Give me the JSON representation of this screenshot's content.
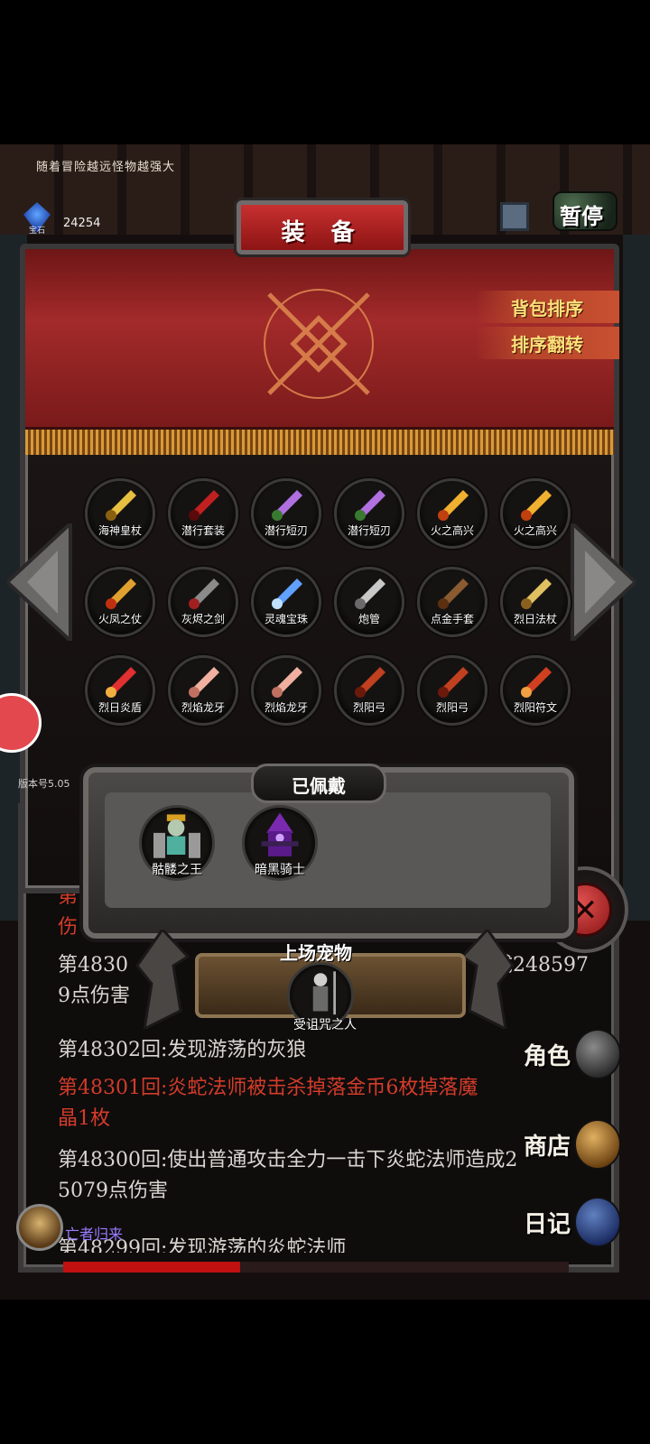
{
  "top_tip": "随着冒险越远怪物越强大",
  "gem": {
    "label": "宝石",
    "count": "24254",
    "icon": "blue-gem-icon"
  },
  "pause_label": "暂停",
  "panel": {
    "title": "装 备",
    "sort_bag": "背包排序",
    "sort_reverse": "排序翻转"
  },
  "items": [
    {
      "label": "海神皇杖",
      "icon": "golden-trident-icon"
    },
    {
      "label": "潜行套装",
      "icon": "red-hood-outfit-icon"
    },
    {
      "label": "潜行短刃",
      "icon": "purple-dagger-icon"
    },
    {
      "label": "潜行短刃",
      "icon": "purple-dagger-icon"
    },
    {
      "label": "火之高兴",
      "icon": "flame-sword-icon"
    },
    {
      "label": "火之高兴",
      "icon": "flame-sword-icon"
    },
    {
      "label": "火凤之仗",
      "icon": "phoenix-staff-icon"
    },
    {
      "label": "灰烬之剑",
      "icon": "ash-blade-icon"
    },
    {
      "label": "灵魂宝珠",
      "icon": "soul-orb-icon"
    },
    {
      "label": "炮管",
      "icon": "cannon-barrel-icon"
    },
    {
      "label": "点金手套",
      "icon": "gauntlet-icon"
    },
    {
      "label": "烈日法杖",
      "icon": "sun-staff-icon"
    },
    {
      "label": "烈日炎盾",
      "icon": "sun-shield-icon"
    },
    {
      "label": "烈焰龙牙",
      "icon": "dragon-fang-icon"
    },
    {
      "label": "烈焰龙牙",
      "icon": "dragon-fang-icon"
    },
    {
      "label": "烈阳弓",
      "icon": "flame-bow-icon"
    },
    {
      "label": "烈阳弓",
      "icon": "flame-bow-icon"
    },
    {
      "label": "烈阳符文",
      "icon": "rune-scroll-icon"
    }
  ],
  "version_label": "版本号5.05",
  "worn": {
    "title": "已佩戴",
    "items": [
      {
        "label": "骷髅之王",
        "icon": "skeleton-king-icon"
      },
      {
        "label": "暗黑骑士",
        "icon": "dark-knight-icon"
      }
    ]
  },
  "pet": {
    "title": "上场宠物",
    "label": "受诅咒之人",
    "icon": "cursed-reaper-icon"
  },
  "log": {
    "partial_top_red_1": "第",
    "partial_top_red_1b": "1",
    "partial_top_red_2": "伤",
    "partial_mid_1": "第4830",
    "partial_mid_1b": "成248597",
    "partial_mid_2": "9点伤害",
    "line1": "第48302回:发现游荡的灰狼",
    "line2": "第48301回:炎蛇法师被击杀掉落金币6枚掉落魔",
    "line3": "晶1枚",
    "line4": "第48300回:使出普通攻击全力一击下炎蛇法师造成2",
    "line5": "5079点伤害",
    "line6": "第48299回:发现游荡的炎蛇法师"
  },
  "menu": {
    "role": "角色",
    "shop": "商店",
    "diary": "日记"
  },
  "player": {
    "name": "亡者归来",
    "hp_fraction": 0.35
  },
  "colors": {
    "banner_red": "#a32a2a",
    "gold_text": "#ffe07a",
    "log_red": "#d33c2a",
    "player_name": "#9a7cff"
  }
}
